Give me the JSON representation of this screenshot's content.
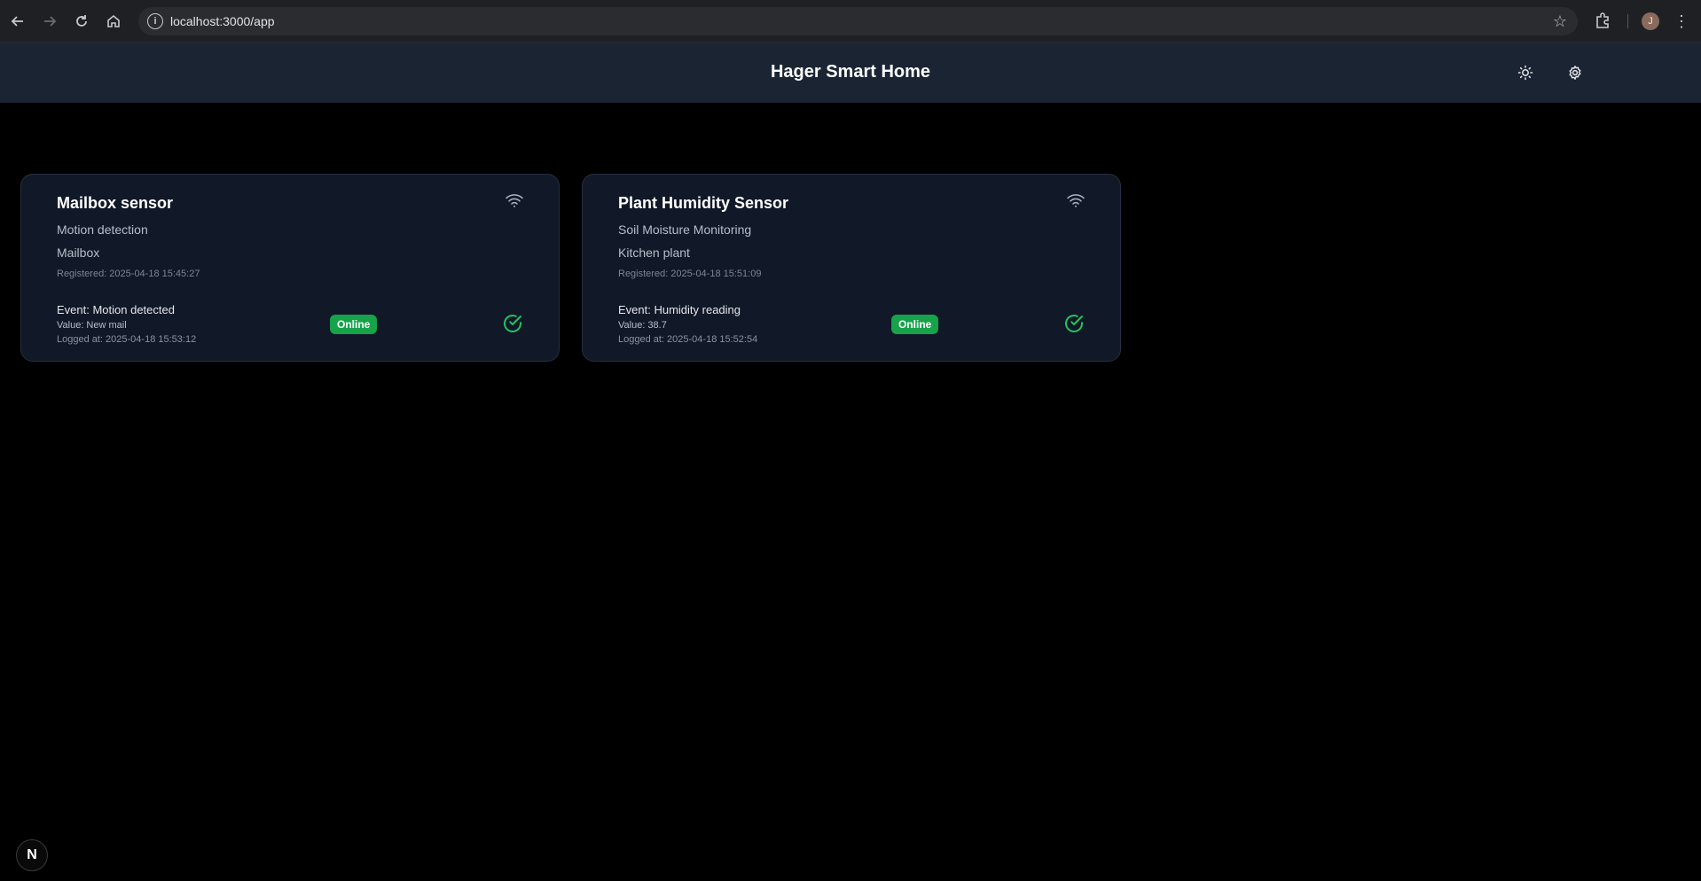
{
  "browser": {
    "url": "localhost:3000/app",
    "avatar_initial": "J"
  },
  "header": {
    "title": "Hager Smart Home"
  },
  "devices": [
    {
      "name": "Mailbox sensor",
      "type": "Motion detection",
      "location": "Mailbox",
      "registered": "Registered: 2025-04-18 15:45:27",
      "event": "Event: Motion detected",
      "value": "Value: New mail",
      "logged": "Logged at: 2025-04-18 15:53:12",
      "status": "Online"
    },
    {
      "name": "Plant Humidity Sensor",
      "type": "Soil Moisture Monitoring",
      "location": "Kitchen plant",
      "registered": "Registered: 2025-04-18 15:51:09",
      "event": "Event: Humidity reading",
      "value": "Value: 38.7",
      "logged": "Logged at: 2025-04-18 15:52:54",
      "status": "Online"
    }
  ],
  "dev_badge": "N",
  "colors": {
    "header_bg": "#1b2433",
    "card_bg": "#111827",
    "online": "#16a34a",
    "check": "#22c55e"
  }
}
